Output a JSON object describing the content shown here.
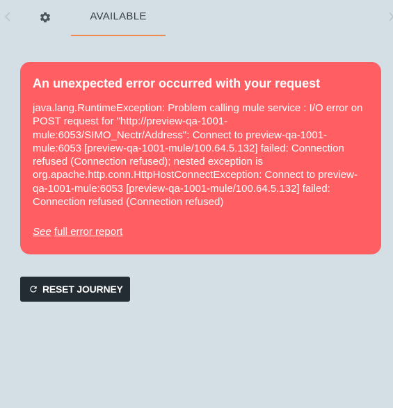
{
  "nav": {
    "tab_label": "AVAILABLE",
    "left_arrow_icon": "chevron-left-icon",
    "right_arrow_icon": "chevron-right-icon",
    "settings_icon": "gear-icon"
  },
  "error": {
    "title": "An unexpected error occurred with your request",
    "message": "java.lang.RuntimeException: Problem calling mule service : I/O error on POST request for \"http://preview-qa-1001-mule:6053/SIMO_Nectr/Address\": Connect to preview-qa-1001-mule:6053 [preview-qa-1001-mule/100.64.5.132] failed: Connection refused (Connection refused); nested exception is org.apache.http.conn.HttpHostConnectException: Connect to preview-qa-1001-mule:6053 [preview-qa-1001-mule/100.64.5.132] failed: Connection refused (Connection refused)",
    "see_text": "See",
    "report_link": "full error report"
  },
  "actions": {
    "reset_label": "RESET JOURNEY",
    "reset_icon": "refresh-icon"
  },
  "colors": {
    "background": "#d4dee5",
    "error_card": "#ff5e63",
    "tab_accent": "#f08a4b",
    "button": "#232b33"
  }
}
